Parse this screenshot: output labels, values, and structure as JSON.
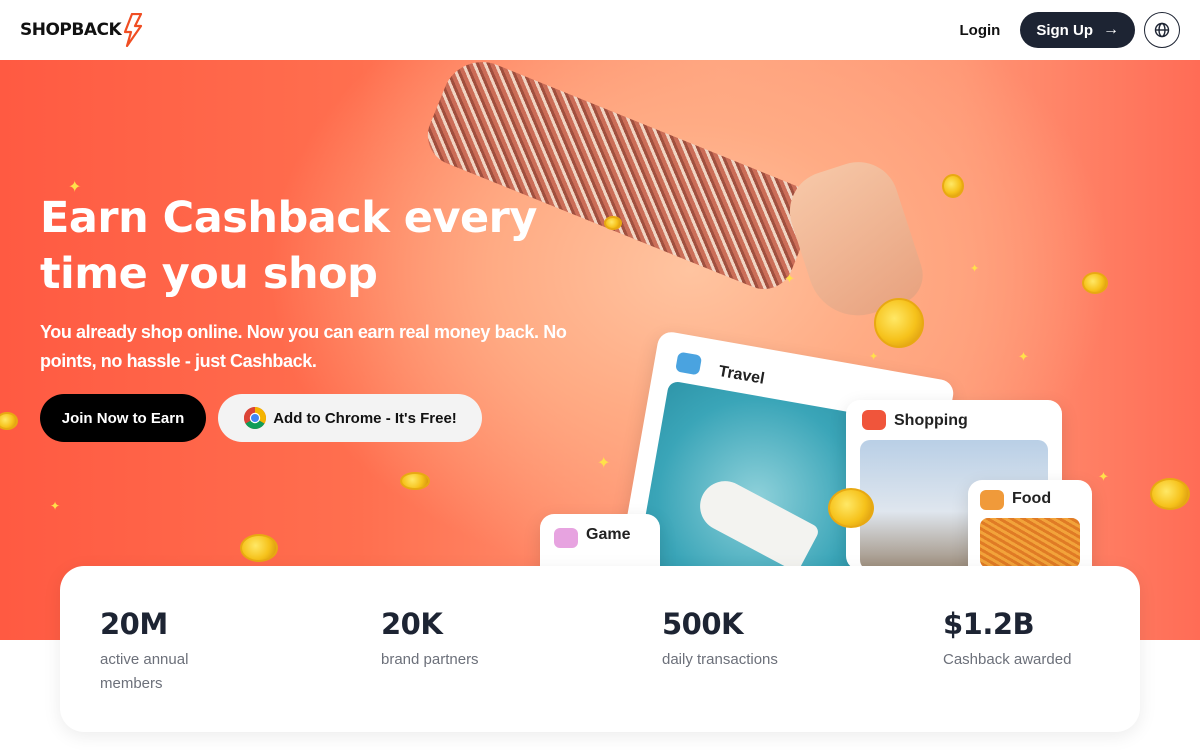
{
  "header": {
    "logo_text": "SHOPBACK",
    "login_label": "Login",
    "signup_label": "Sign Up",
    "signup_icon": "arrow-right-icon",
    "language_icon": "globe-icon"
  },
  "hero": {
    "title": "Earn Cashback every time you shop",
    "subtitle": "You already shop online. Now you can earn real money back. No points, no hassle - just Cashback.",
    "join_button": "Join Now to Earn",
    "chrome_button": "Add to Chrome - It's Free!",
    "chrome_icon": "chrome-icon"
  },
  "categories": {
    "travel": "Travel",
    "shopping": "Shopping",
    "food": "Food",
    "game": "Game"
  },
  "stats": [
    {
      "value": "20M",
      "label": "active annual members"
    },
    {
      "value": "20K",
      "label": "brand partners"
    },
    {
      "value": "500K",
      "label": "daily transactions"
    },
    {
      "value": "$1.2B",
      "label": "Cashback awarded"
    }
  ],
  "colors": {
    "brand_orange": "#ff5a42",
    "dark_navy": "#1d2433",
    "coin_gold": "#f6c21b"
  }
}
